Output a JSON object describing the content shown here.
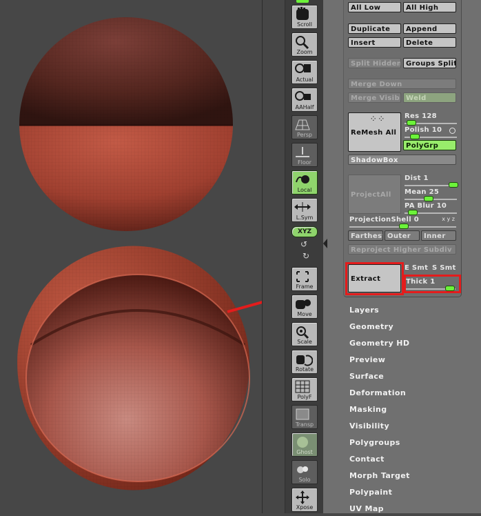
{
  "toolbar": {
    "scroll": "Scroll",
    "zoom": "Zoom",
    "actual": "Actual",
    "aahalf": "AAHalf",
    "persp": "Persp",
    "floor": "Floor",
    "local": "Local",
    "lsym": "L.Sym",
    "xyz": "XYZ",
    "frame": "Frame",
    "move": "Move",
    "scale": "Scale",
    "rotate": "Rotate",
    "polyf": "PolyF",
    "transp": "Transp",
    "ghost": "Ghost",
    "solo": "Solo",
    "xpose": "Xpose"
  },
  "subtool": {
    "all_low": "All Low",
    "all_high": "All High",
    "duplicate": "Duplicate",
    "append": "Append",
    "insert": "Insert",
    "delete": "Delete",
    "split_hidden": "Split Hidden",
    "groups_split": "Groups Split",
    "merge_down": "Merge Down",
    "merge_visible": "Merge Visible",
    "weld": "Weld",
    "remesh_all": "ReMesh All",
    "res": {
      "label": "Res",
      "value": "128",
      "level": 0.12
    },
    "polish": {
      "label": "Polish",
      "value": "10",
      "level": 0.18
    },
    "polygrp": "PolyGrp",
    "shadowbox": "ShadowBox",
    "project_all": "ProjectAll",
    "dist": {
      "label": "Dist",
      "value": "1",
      "level": 0.92
    },
    "mean": {
      "label": "Mean",
      "value": "25",
      "level": 0.45
    },
    "pa_blur": {
      "label": "PA Blur",
      "value": "10",
      "level": 0.15
    },
    "projection_shell": {
      "label": "ProjectionShell",
      "value": "0",
      "level": 0.5
    },
    "xyz_small": "x y z",
    "farthest": "Farthest",
    "outer": "Outer",
    "inner": "Inner",
    "reproject": "Reproject Higher Subdiv",
    "extract": "Extract",
    "e_smt": "E Smt",
    "s_smt": "S Smt",
    "thick": {
      "label": "Thick",
      "value": "1",
      "level": 0.88
    }
  },
  "menus": [
    "Layers",
    "Geometry",
    "Geometry HD",
    "Preview",
    "Surface",
    "Deformation",
    "Masking",
    "Visibility",
    "Polygroups",
    "Contact",
    "Morph Target",
    "Polypaint",
    "UV Map"
  ],
  "colors": {
    "accent_green": "#98ec6b",
    "highlight_red": "#e41c1c",
    "mesh_red": "#b3402c"
  }
}
